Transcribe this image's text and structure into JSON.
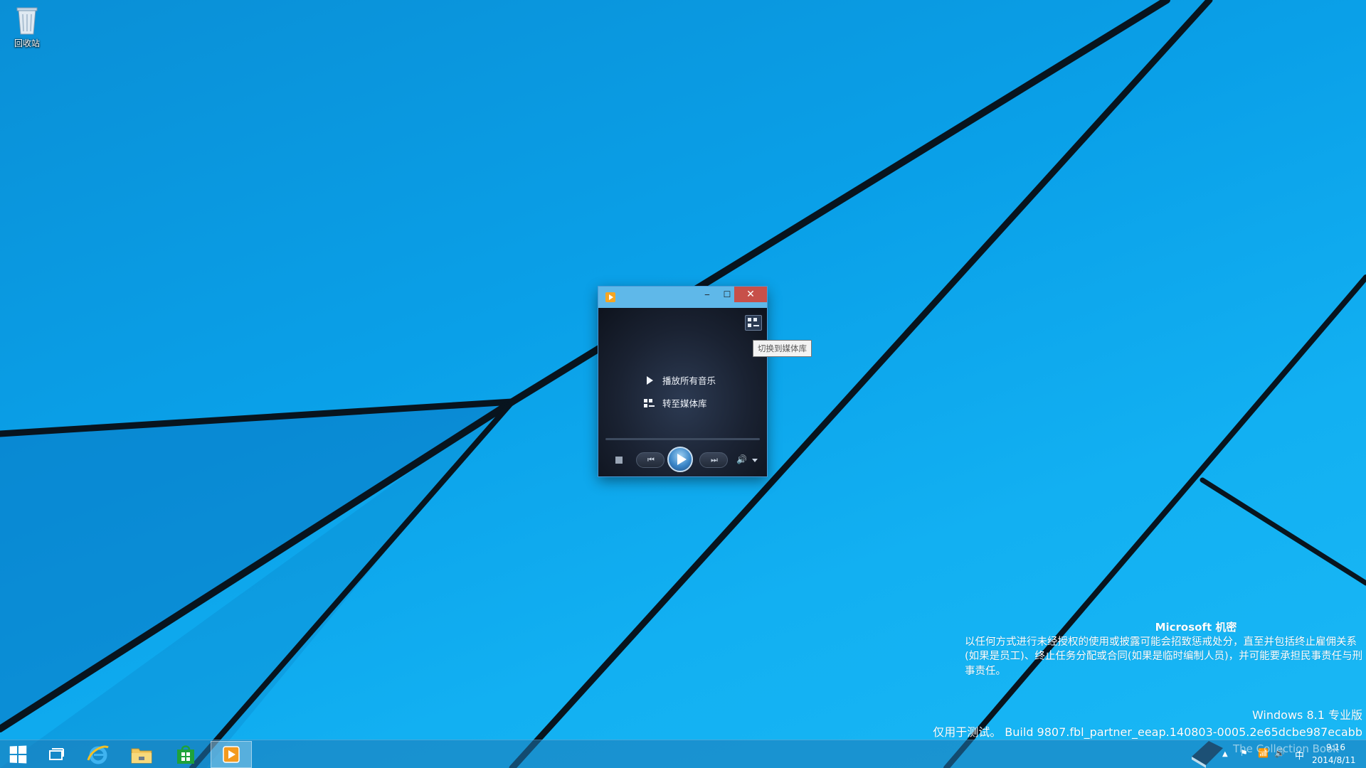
{
  "desktop": {
    "icons": [
      {
        "label": "回收站",
        "icon": "recycle-bin-icon"
      }
    ]
  },
  "wmp_window": {
    "title": "",
    "controls": {
      "minimize": "‒",
      "maximize": "☐",
      "close": "✕"
    },
    "menu": {
      "play_all_music": "播放所有音乐",
      "go_to_library": "转至媒体库"
    },
    "tooltip": "切换到媒体库",
    "playback": {
      "progress": 0,
      "prev_label": "⏮",
      "next_label": "⏭",
      "volume_label": "🔊"
    }
  },
  "watermark": {
    "title": "Microsoft 机密",
    "body": "以任何方式进行未经授权的使用或披露可能会招致惩戒处分，直至并包括终止雇佣关系(如果是员工)、终止任务分配或合同(如果是临时编制人员)，并可能要承担民事责任与刑事责任。",
    "edition": "Windows 8.1 专业版",
    "build": "仅用于测试。 Build 9807.fbl_partner_eeap.140803-0005.2e65dcbe987ecabb"
  },
  "taskbar": {
    "pinned": [
      {
        "name": "start-button",
        "icon": "windows-logo-icon"
      },
      {
        "name": "taskview-button",
        "icon": "task-view-icon"
      },
      {
        "name": "ie-button",
        "icon": "internet-explorer-icon"
      },
      {
        "name": "explorer-button",
        "icon": "file-explorer-icon"
      },
      {
        "name": "store-button",
        "icon": "store-icon"
      },
      {
        "name": "wmp-taskbar-button",
        "icon": "media-player-icon"
      }
    ],
    "tray": {
      "show_hidden": "▲",
      "flag": "⚑",
      "network": "📶",
      "volume": "🔊",
      "ime": "中",
      "time": "9:16",
      "date": "2014/8/11"
    },
    "publisher": "The Collection Book"
  },
  "colors": {
    "wallpaper_blue": "#0aa0e8",
    "close_red": "#c7504a",
    "titlebar_blue": "#5fb8e9",
    "wmp_dark": "#1b2230"
  }
}
